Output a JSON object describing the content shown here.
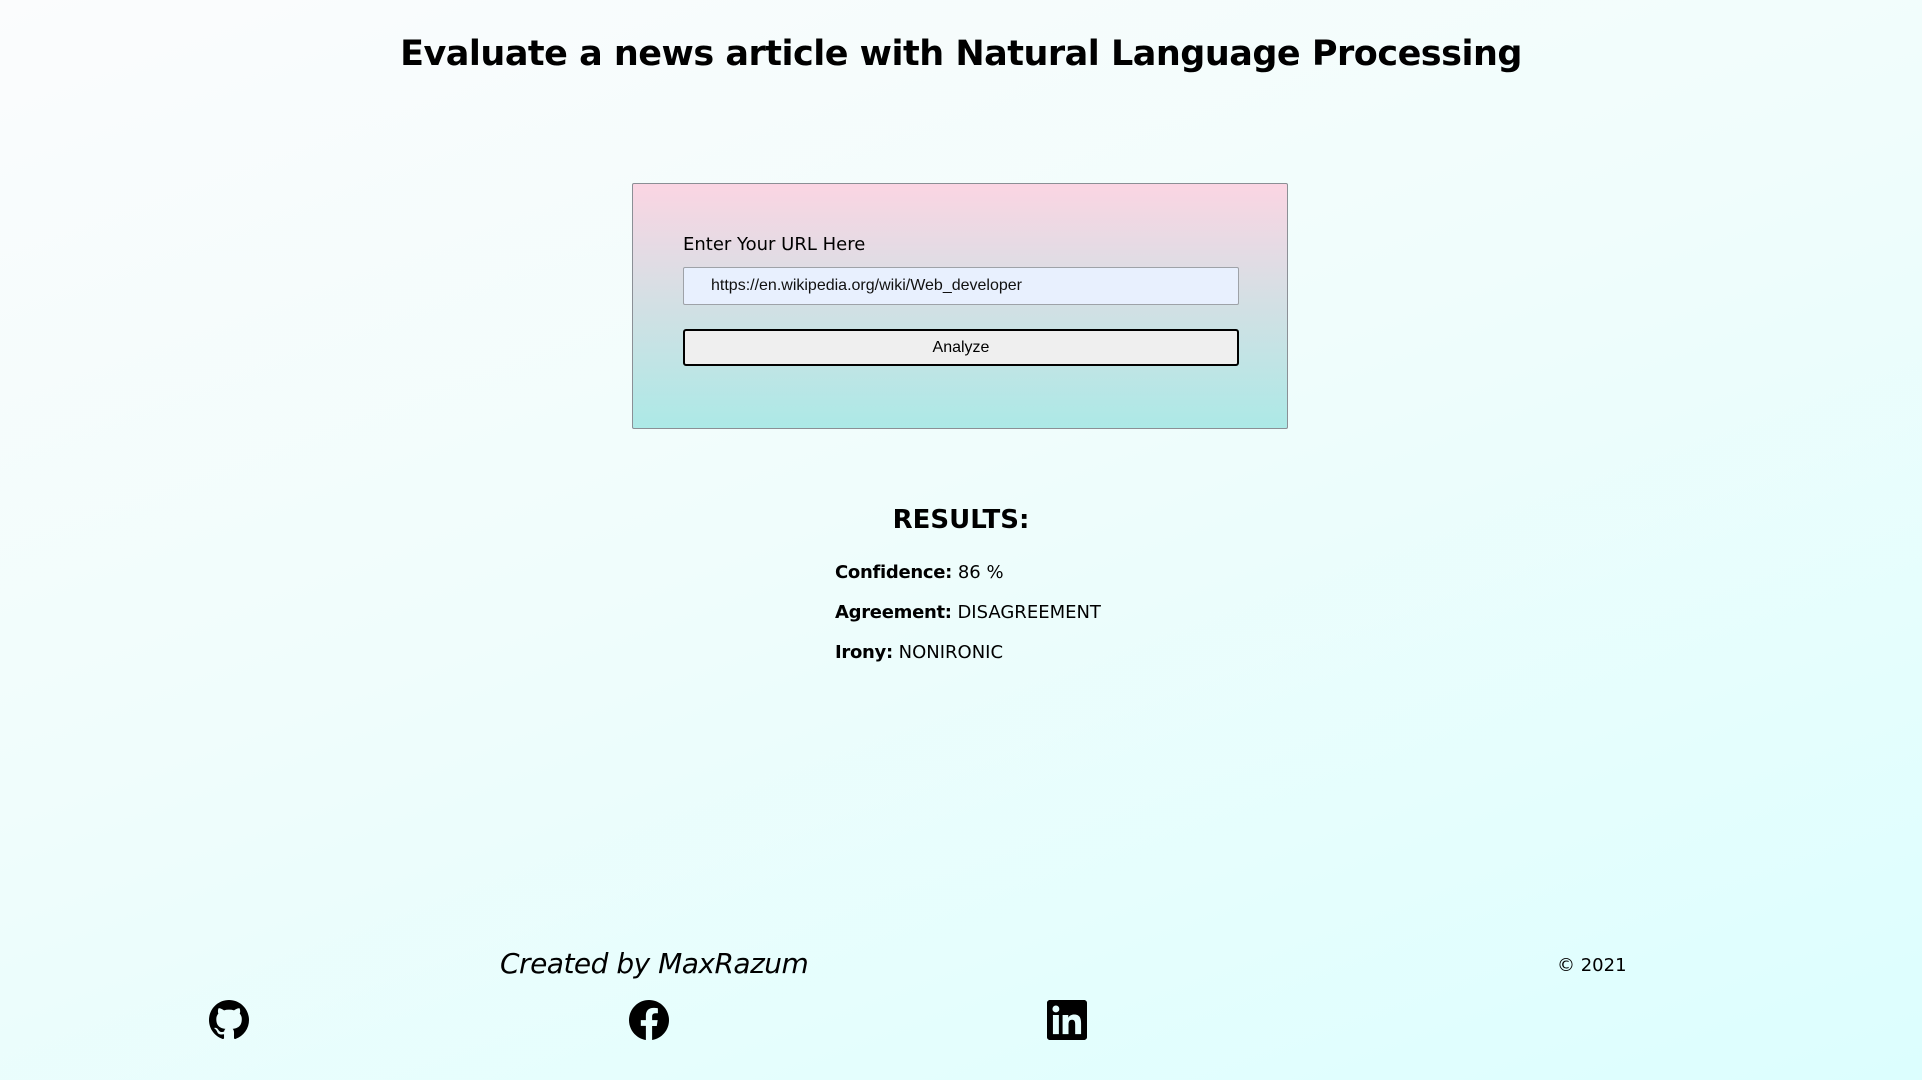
{
  "header": {
    "title": "Evaluate a news article with Natural Language Processing"
  },
  "form": {
    "label": "Enter Your URL Here",
    "url_value": "https://en.wikipedia.org/wiki/Web_developer",
    "submit_label": "Analyze"
  },
  "results": {
    "heading": "RESULTS:",
    "items": [
      {
        "key": "Confidence:",
        "value": "86 %"
      },
      {
        "key": "Agreement:",
        "value": "DISAGREEMENT"
      },
      {
        "key": "Irony:",
        "value": "NONIRONIC"
      }
    ]
  },
  "footer": {
    "credit": "Created by MaxRazum",
    "copyright": "© 2021",
    "social": [
      {
        "icon": "github-icon"
      },
      {
        "icon": "facebook-icon"
      },
      {
        "icon": "linkedin-icon"
      }
    ]
  },
  "colors": {
    "card_top": "#fbd5e3",
    "card_bottom": "#ace9e6",
    "input_background": "#e8f0fe",
    "page_background_end": "#dcfefe"
  }
}
